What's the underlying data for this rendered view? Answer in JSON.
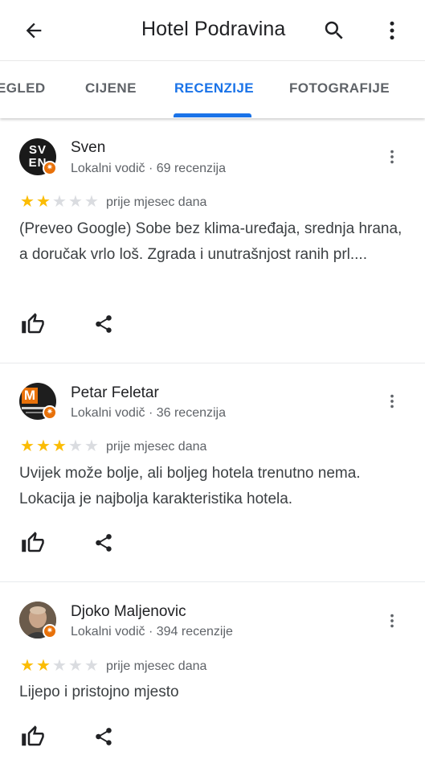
{
  "header": {
    "title": "Hotel Podravina",
    "back_icon": "arrow-back-icon",
    "search_icon": "search-icon",
    "more_icon": "more-vert-icon"
  },
  "tabs": [
    {
      "label": "EGLED",
      "active": false
    },
    {
      "label": "CIJENE",
      "active": false
    },
    {
      "label": "RECENZIJE",
      "active": true
    },
    {
      "label": "FOTOGRAFIJE",
      "active": false
    }
  ],
  "colors": {
    "accent": "#1a73e8",
    "star": "#fbbc04",
    "badge": "#e8710a"
  },
  "reviews": [
    {
      "name": "Sven",
      "meta": "Lokalni vodič · 69 recenzija",
      "avatar_text": "SV EN",
      "rating": 2,
      "date": "prije mjesec dana",
      "text": "(Preveo Google) Sobe bez klima-uređaja, srednja hrana, a doručak vrlo loš. Zgrada i unutrašnjost ranih prl...."
    },
    {
      "name": "Petar Feletar",
      "meta": "Lokalni vodič · 36 recenzija",
      "avatar_text": "M",
      "rating": 3,
      "date": "prije mjesec dana",
      "text": "Uvijek može bolje, ali boljeg hotela trenutno nema. Lokacija je najbolja karakteristika hotela."
    },
    {
      "name": "Djoko Maljenovic",
      "meta": "Lokalni vodič · 394 recenzije",
      "avatar_text": "",
      "rating": 2,
      "date": "prije mjesec dana",
      "text": "Lijepo i pristojno mjesto"
    }
  ]
}
